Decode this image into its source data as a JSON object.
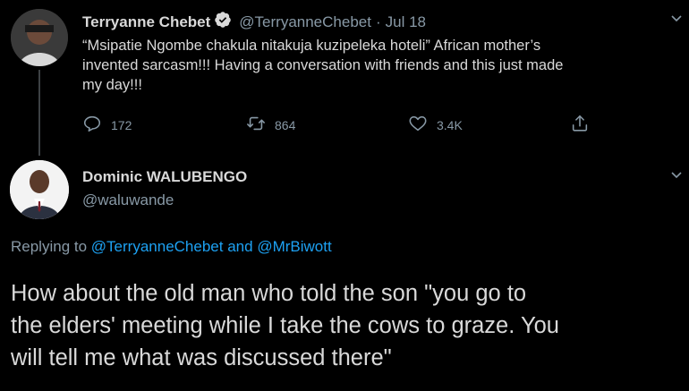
{
  "tweet1": {
    "author_name": "Terryanne Chebet",
    "handle": "@TerryanneChebet",
    "separator": "·",
    "date": "Jul 18",
    "text_line1": "“Msipatie Ngombe chakula nitakuja kuzipeleka hoteli” African mother’s",
    "text_line2": "invented sarcasm!!!  Having a conversation with friends and this just made",
    "text_line3": "my day!!!",
    "replies": "172",
    "retweets": "864",
    "likes": "3.4K"
  },
  "tweet2": {
    "author_name": "Dominic WALUBENGO",
    "handle": "@waluwande",
    "replying_prefix": "Replying to",
    "reply_user1": "@TerryanneChebet",
    "reply_and": "and",
    "reply_user2": "@MrBiwott",
    "text_line1": "How about the old man who told the son \"you go to",
    "text_line2": "the elders' meeting while I take the cows to graze. You",
    "text_line3": "will tell me what was discussed there\""
  },
  "icons": {
    "verified": "verified-badge-icon",
    "reply": "reply-icon",
    "retweet": "retweet-icon",
    "like": "like-icon",
    "share": "share-icon",
    "chevron": "chevron-down-icon"
  },
  "colors": {
    "background": "#000000",
    "text": "#d9d9d9",
    "muted": "#8899a6",
    "link": "#1da1f2"
  }
}
